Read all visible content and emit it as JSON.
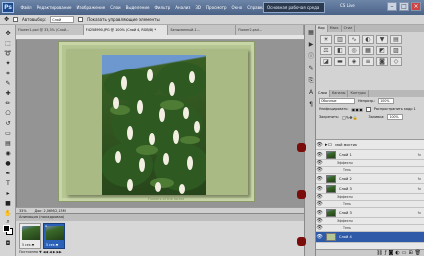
{
  "menubar": {
    "logo": "Ps",
    "items": [
      "Файл",
      "Редактирование",
      "Изображение",
      "Слои",
      "Выделение",
      "Фильтр",
      "Анализ",
      "3D",
      "Просмотр",
      "Окно",
      "Справка"
    ],
    "workspace": "Основная рабочая среда",
    "cs_live": "CS Live"
  },
  "options": {
    "autoselect_label": "Автовыбор:",
    "autoselect_value": "Слой",
    "show_controls": "Показать управляющие элементы"
  },
  "tabs": [
    "Flower1.psd @ 33,3% (Слой...",
    "F4258990.JPG @ 100% (Слой 4, RGB/8) *",
    "Безымянный-1...",
    "Flower2.psd..."
  ],
  "status": {
    "zoom": "33%",
    "doc": "Док: 2,06M/2,15M"
  },
  "watermark": "Flowers of the forest",
  "animation": {
    "title": "Анимация (покадровая)",
    "frames": [
      {
        "num": "1",
        "duration": "5 сек.▼"
      },
      {
        "num": "2",
        "duration": "5 сек.▼"
      }
    ],
    "controls": "Постоянно ▼   ◀◀  ◀  ▶  ▶▶"
  },
  "right_panel": {
    "top_tabs": [
      "Кор",
      "Маск",
      "Стил"
    ],
    "layers_tabs": [
      "Слои",
      "Каналы",
      "Контуры"
    ],
    "blend_mode": "Обычные",
    "opacity_label": "Непрозр.:",
    "opacity": "100%",
    "unify_label": "Унифицировать:",
    "propagate_label": "Распространить кадр 1",
    "lock_label": "Закрепить:",
    "fill_label": "Заливка:",
    "fill": "100%",
    "layers": [
      {
        "name": "мой мостик",
        "kind": "folder",
        "fx": ""
      },
      {
        "name": "Слой 1",
        "kind": "layer",
        "fx": "fx"
      },
      {
        "name": "Эффекты",
        "kind": "sub",
        "fx": ""
      },
      {
        "name": "Тень",
        "kind": "sub",
        "fx": ""
      },
      {
        "name": "Слой 2",
        "kind": "layer",
        "fx": "fx"
      },
      {
        "name": "Слой 3",
        "kind": "layer",
        "fx": "fx"
      },
      {
        "name": "Эффекты",
        "kind": "sub",
        "fx": ""
      },
      {
        "name": "Тень",
        "kind": "sub",
        "fx": ""
      },
      {
        "name": "Слой 3",
        "kind": "layer",
        "fx": "fx"
      },
      {
        "name": "Эффекты",
        "kind": "sub",
        "fx": ""
      },
      {
        "name": "Тень",
        "kind": "sub",
        "fx": ""
      },
      {
        "name": "Слой 4",
        "kind": "layer",
        "fx": ""
      }
    ]
  }
}
